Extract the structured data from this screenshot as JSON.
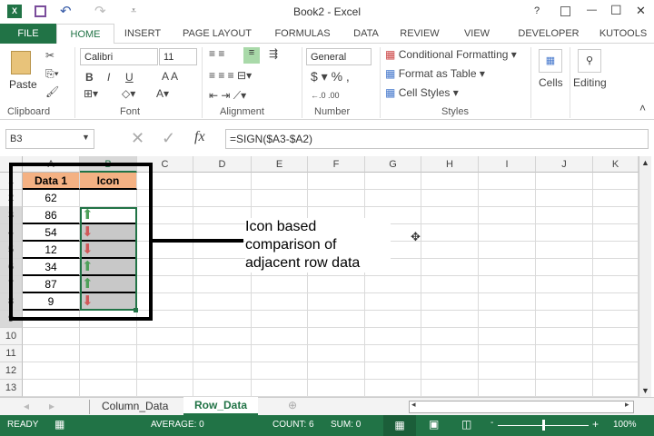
{
  "window": {
    "title": "Book2 - Excel",
    "help": "?",
    "minimize": "—",
    "maximize": "☐",
    "close": "✕"
  },
  "tabs": [
    "FILE",
    "HOME",
    "INSERT",
    "PAGE LAYOUT",
    "FORMULAS",
    "DATA",
    "REVIEW",
    "VIEW",
    "DEVELOPER",
    "KUTOOLS"
  ],
  "ribbon": {
    "paste": "Paste",
    "font_name": "Calibri",
    "font_size": "11",
    "bold": "B",
    "italic": "I",
    "underline": "U",
    "number_format": "General",
    "conditional_formatting": "Conditional Formatting",
    "format_as_table": "Format as Table",
    "cell_styles": "Cell Styles",
    "cells": "Cells",
    "editing": "Editing",
    "groups": [
      "Clipboard",
      "Font",
      "Alignment",
      "Number",
      "Styles"
    ]
  },
  "formula_bar": {
    "name_box": "B3",
    "formula": "=SIGN($A3-$A2)",
    "fx": "fx"
  },
  "columns": [
    "A",
    "B",
    "C",
    "D",
    "E",
    "F",
    "G",
    "H",
    "I",
    "J",
    "K"
  ],
  "rows": [
    "1",
    "2",
    "3",
    "4",
    "5",
    "6",
    "7",
    "8",
    "9",
    "10",
    "11",
    "12",
    "13"
  ],
  "table": {
    "headers": [
      "Data 1",
      "Icon"
    ],
    "values": [
      "62",
      "86",
      "54",
      "12",
      "34",
      "87",
      "9"
    ],
    "icons": [
      "",
      "up",
      "down",
      "down",
      "up",
      "up",
      "down"
    ]
  },
  "annotation": "Icon based comparison of adjacent row data",
  "sheets": [
    {
      "name": "Column_Data",
      "active": false
    },
    {
      "name": "Row_Data",
      "active": true
    }
  ],
  "status": {
    "ready": "READY",
    "average": "AVERAGE: 0",
    "count": "COUNT: 6",
    "sum": "SUM: 0",
    "zoom": "100%",
    "zoom_fraction": 0.5
  },
  "colors": {
    "excel_green": "#217346",
    "header_orange": "#f4b183",
    "up": "#4ea05a",
    "down": "#d05858"
  }
}
